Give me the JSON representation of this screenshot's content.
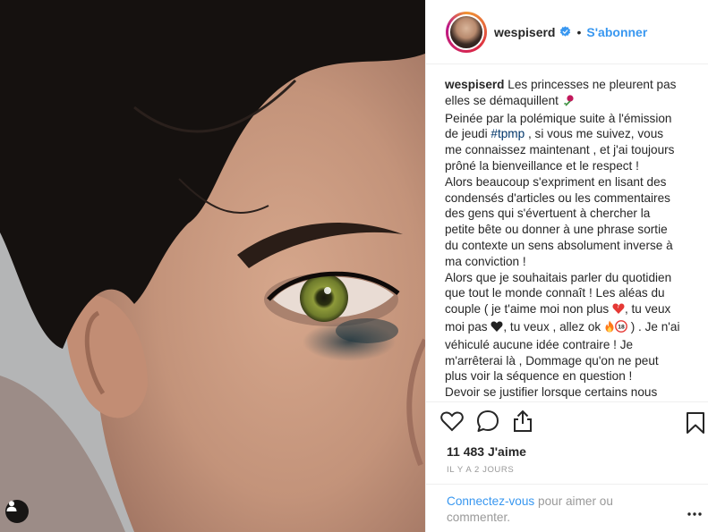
{
  "header": {
    "username": "wespiserd",
    "separator": "•",
    "follow_label": "S'abonner"
  },
  "caption": {
    "username": "wespiserd",
    "line1": " Les princesses ne pleurent pas elles se démaquillent ",
    "p1_a": "Peinée par la polémique suite à l'émission de jeudi ",
    "hashtag": "#tpmp",
    "p1_b": " , si vous me suivez, vous me connaissez maintenant , et j'ai toujours prôné la bienveillance et le respect !",
    "p2": "Alors beaucoup s'expriment en lisant des condensés d'articles ou les commentaires des gens qui s'évertuent à chercher la petite bête ou donner à une phrase sortie du contexte un sens absolument inverse à ma conviction !",
    "p3_a": "Alors que je souhaitais parler du quotidien que tout le monde connaît ! Les aléas du couple ( je t'aime moi non plus ",
    "p3_b": ", tu veux moi pas ",
    "p3_c": ", tu veux , allez ok ",
    "p3_d": " ) . Je n'ai véhiculé aucune idée contraire ! Je m'arrêterai là , Dommage qu'on ne peut plus voir la séquence en question !",
    "p4": "Devoir se justifier lorsque certains nous",
    "emoji_18": "18"
  },
  "actions": {
    "like_icon": "heart-outline-icon",
    "comment_icon": "comment-bubble-icon",
    "share_icon": "share-icon",
    "save_icon": "bookmark-icon"
  },
  "likes": "11 483 J'aime",
  "time": "IL Y A 2 JOURS",
  "comment": {
    "login_label": "Connectez-vous",
    "rest": " pour aimer ou commenter."
  },
  "colors": {
    "accent": "#3897f0",
    "text": "#262626",
    "muted": "#999999",
    "border": "#efefef"
  }
}
